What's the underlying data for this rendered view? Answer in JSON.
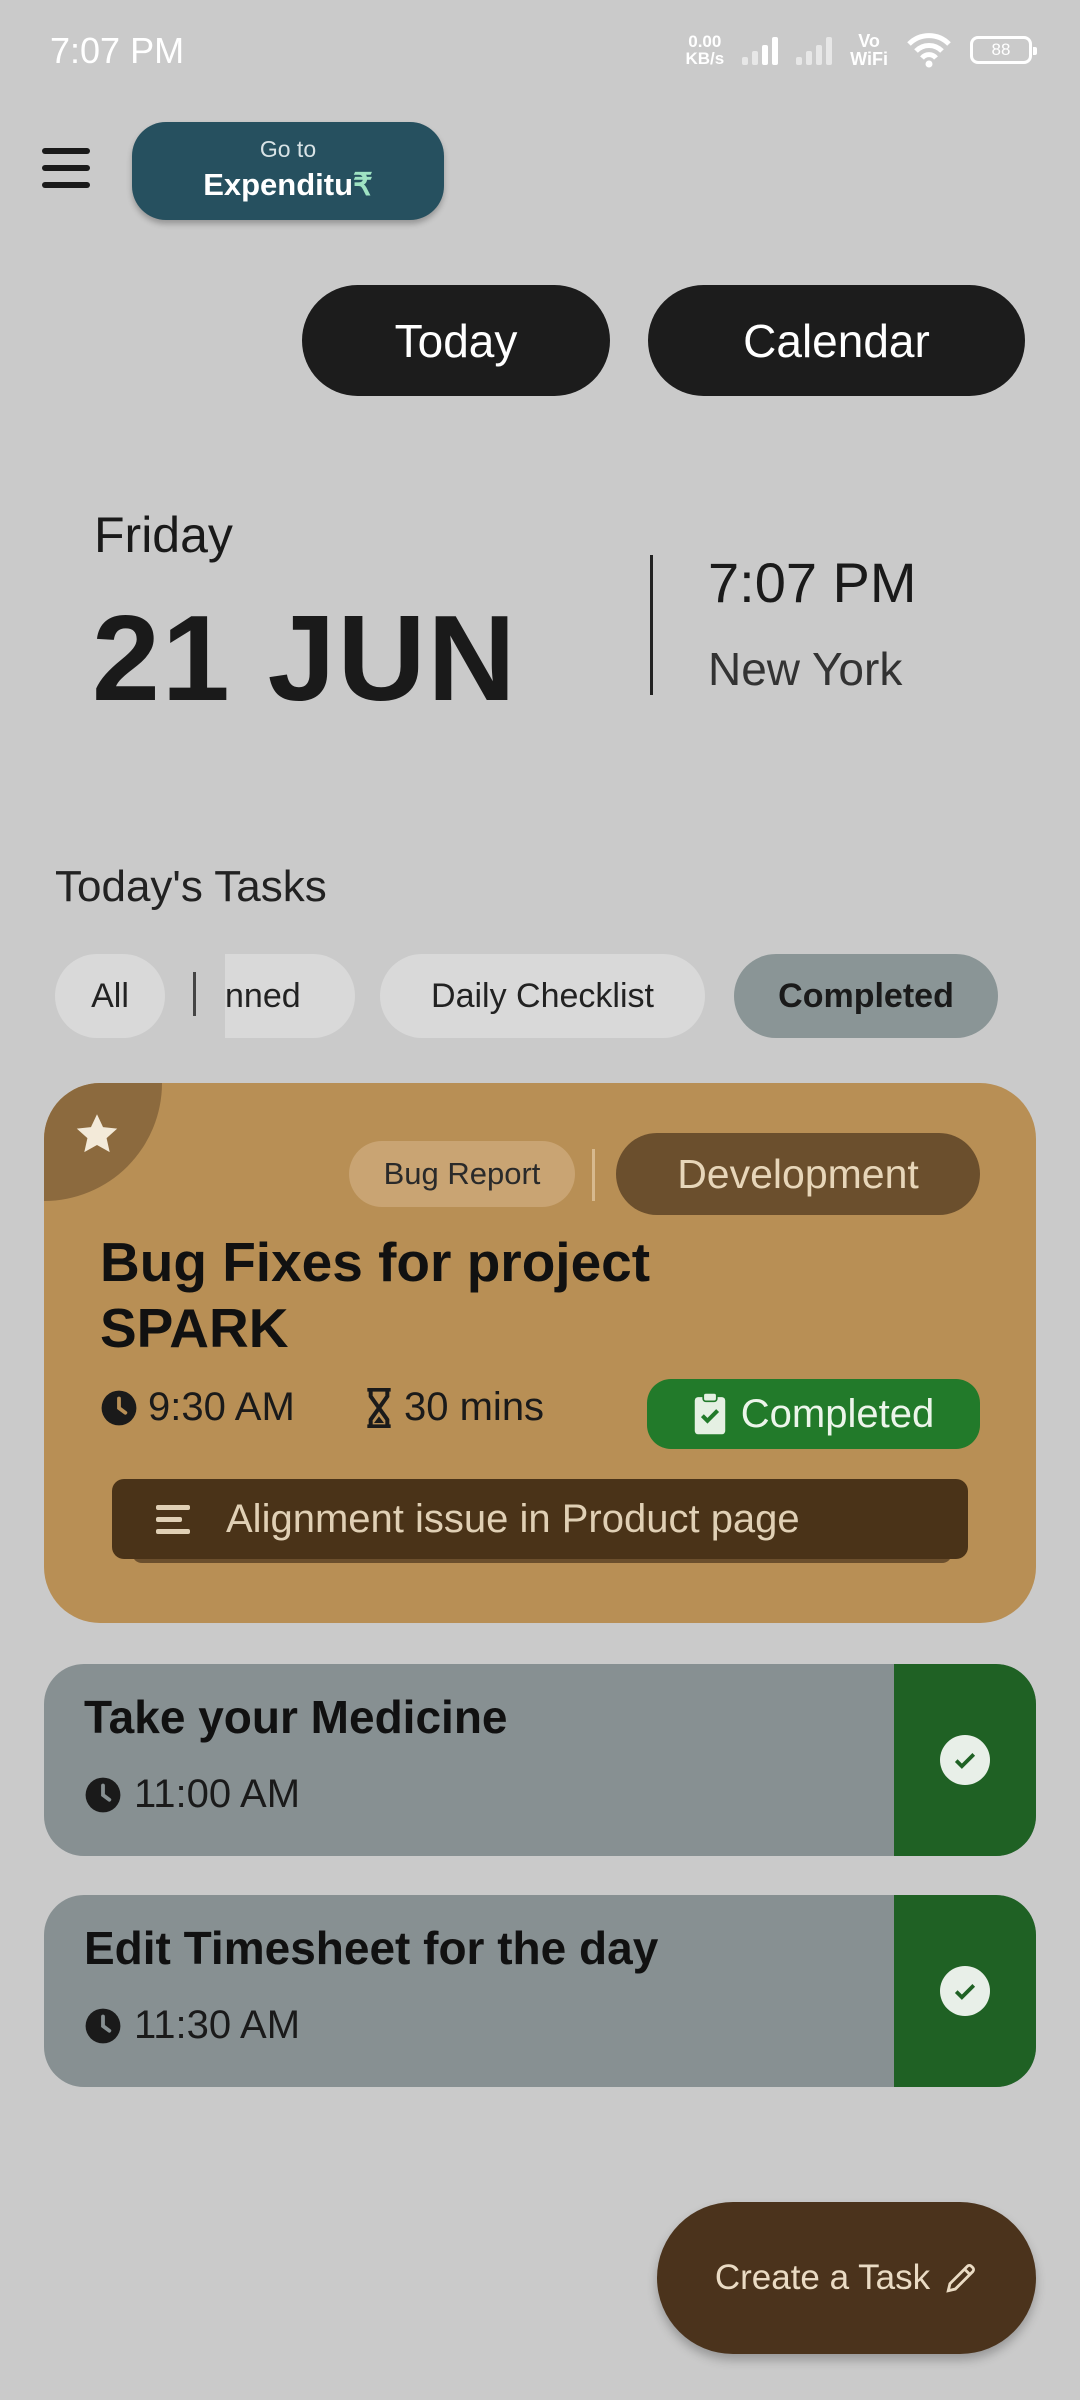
{
  "status_bar": {
    "time": "7:07 PM",
    "net_speed_value": "0.00",
    "net_speed_unit": "KB/s",
    "vowifi_top": "Vo",
    "vowifi_bottom": "WiFi",
    "battery": "88"
  },
  "header": {
    "goto_label": "Go to",
    "expenditure_label": "Expenditu",
    "expenditure_symbol": "₹",
    "today_button": "Today",
    "calendar_button": "Calendar"
  },
  "date": {
    "day_name": "Friday",
    "date_big": "21 JUN",
    "clock": "7:07 PM",
    "city": "New York"
  },
  "tasks_section": {
    "title": "Today's Tasks",
    "filters": {
      "all": "All",
      "planned": "nned",
      "daily_checklist": "Daily Checklist",
      "completed": "Completed",
      "active": "completed"
    }
  },
  "main_task": {
    "tag_small": "Bug Report",
    "tag_category": "Development",
    "title": "Bug Fixes for project SPARK",
    "time": "9:30 AM",
    "duration": "30 mins",
    "status": "Completed",
    "description": "Alignment issue in Product page",
    "starred": true
  },
  "other_tasks": [
    {
      "title": "Take your Medicine",
      "time": "11:00 AM",
      "done": true
    },
    {
      "title": "Edit Timesheet for the day",
      "time": "11:30 AM",
      "done": true
    }
  ],
  "fab": {
    "label": "Create a Task"
  },
  "colors": {
    "background": "#cacaca",
    "expenditure_button": "#26505f",
    "main_card": "#b88f55",
    "category_tag": "#6b4f2d",
    "completed_badge": "#227a2a",
    "small_card": "#879092",
    "done_side": "#1f6124",
    "fab": "#4b331c"
  }
}
